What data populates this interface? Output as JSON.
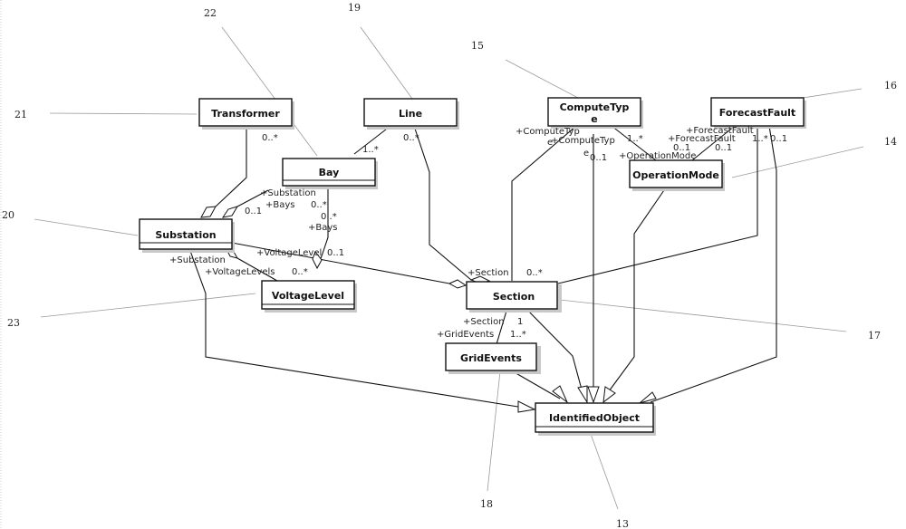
{
  "diagram": {
    "type": "uml-class-diagram",
    "classes": [
      {
        "id": "transformer",
        "name": "Transformer",
        "ref": "21"
      },
      {
        "id": "line",
        "name": "Line",
        "ref": "19"
      },
      {
        "id": "bay",
        "name": "Bay",
        "ref": "22"
      },
      {
        "id": "substation",
        "name": "Substation",
        "ref": "20"
      },
      {
        "id": "voltage-level",
        "name": "VoltageLevel",
        "ref": "23"
      },
      {
        "id": "compute-type",
        "name": "ComputeTyp\ne",
        "name_line1": "ComputeTyp",
        "name_line2": "e",
        "ref": "15"
      },
      {
        "id": "forecast-fault",
        "name": "ForecastFault",
        "ref": "16"
      },
      {
        "id": "operation-mode",
        "name": "OperationMode",
        "ref": "14"
      },
      {
        "id": "section",
        "name": "Section",
        "ref": "17"
      },
      {
        "id": "grid-events",
        "name": "GridEvents",
        "ref": "18"
      },
      {
        "id": "identified-object",
        "name": "IdentifiedObject",
        "ref": "13"
      }
    ],
    "refs": {
      "r13": "13",
      "r14": "14",
      "r15": "15",
      "r16": "16",
      "r17": "17",
      "r18": "18",
      "r19": "19",
      "r20": "20",
      "r21": "21",
      "r22": "22",
      "r23": "23"
    },
    "labels": {
      "transformer_mult": "0..*",
      "line_bay_mult": "1..*",
      "line_section_mult": "0..*",
      "sub_bays_role_sub": "+Substation",
      "sub_bays_role_bays": "+Bays",
      "sub_bays_mult_01": "0..1",
      "sub_bays_mult_0star": "0..*",
      "bay_vl_mult": "0..*",
      "bay_vl_role": "+Bays",
      "vl_section_role": "+VoltageLevel",
      "vl_section_mult": "0..1",
      "sub_vl_role_sub": "+Substation",
      "sub_vl_role_vls": "+VoltageLevels",
      "sub_vl_mult": "0..*",
      "section_top_role": "+Section",
      "section_top_mult": "0..*",
      "ct_role1": "+ComputeTyp",
      "ct_role1b": "e",
      "ct_role2": "+ComputeTyp",
      "ct_role2b": "e",
      "ct_mult": "0..1",
      "ct_om_mult": "1..*",
      "om_role": "+OperationMode",
      "ff_role1": "+ForecastFault",
      "ff_role2": "+ForecastFault",
      "ff_mult_a": "0..1",
      "ff_mult_b": "0..1",
      "ff_mult_c": "1..*",
      "ff_mult_d": "0..1",
      "sec_ge_role_sec": "+Section",
      "sec_ge_mult_1": "1",
      "sec_ge_role_ge": "+GridEvents",
      "sec_ge_mult_many": "1..*"
    }
  }
}
